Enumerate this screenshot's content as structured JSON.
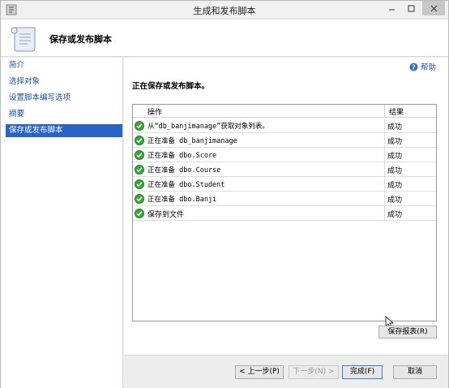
{
  "window": {
    "title": "生成和发布脚本"
  },
  "header": {
    "title": "保存或发布脚本"
  },
  "sidebar": {
    "items": [
      {
        "label": "简介"
      },
      {
        "label": "选择对象"
      },
      {
        "label": "设置脚本编写选项"
      },
      {
        "label": "摘要"
      },
      {
        "label": "保存或发布脚本",
        "active": true
      }
    ]
  },
  "main": {
    "help_label": "帮助",
    "status_text": "正在保存或发布脚本。",
    "grid": {
      "columns": [
        "操作",
        "结果"
      ],
      "rows": [
        {
          "op": "从“db_banjimanage”获取对象列表。",
          "result": "成功"
        },
        {
          "op": "正在准备 db_banjimanage",
          "result": "成功"
        },
        {
          "op": "正在准备 dbo.Score",
          "result": "成功"
        },
        {
          "op": "正在准备 dbo.Course",
          "result": "成功"
        },
        {
          "op": "正在准备 dbo.Student",
          "result": "成功"
        },
        {
          "op": "正在准备 dbo.Banji",
          "result": "成功"
        },
        {
          "op": "保存到文件",
          "result": "成功"
        }
      ]
    },
    "save_report_label": "保存报表(R)"
  },
  "footer": {
    "prev_label": "< 上一步(P)",
    "next_label": "下一步(N) >",
    "finish_label": "完成(F)",
    "cancel_label": "取消"
  },
  "colors": {
    "accent": "#2864c8",
    "link": "#1f4e9c",
    "success": "#3aa83a"
  }
}
